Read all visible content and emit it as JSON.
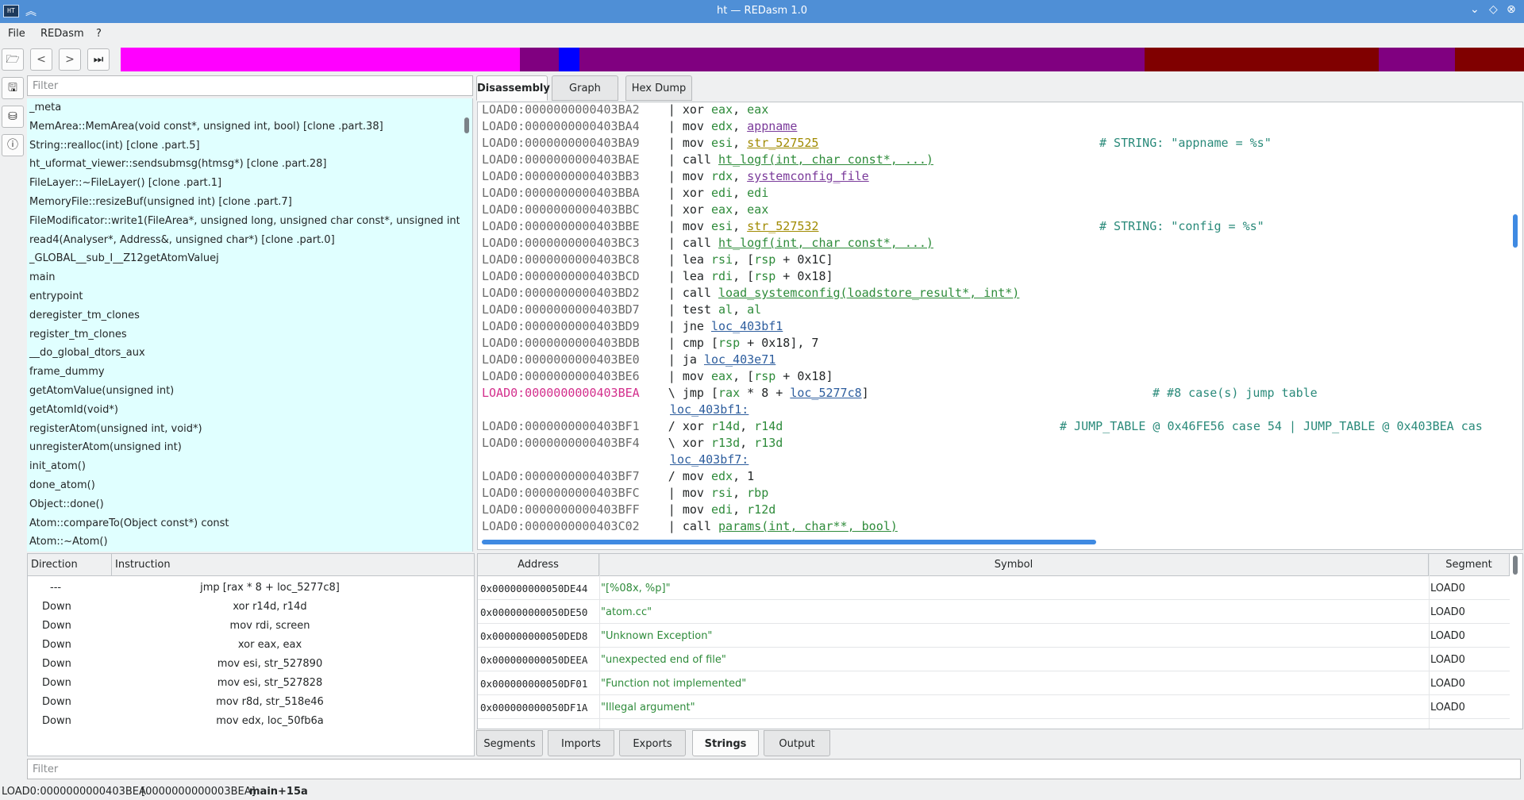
{
  "window": {
    "title": "ht — REDasm 1.0",
    "icon_label": "HT"
  },
  "menu": {
    "items": [
      "File",
      "REDasm",
      "?"
    ]
  },
  "toolbar": {
    "open_icon": "folder-open-icon",
    "back_icon": "arrow-left-icon",
    "forward_icon": "arrow-right-icon",
    "goto_icon": "fast-forward-icon"
  },
  "navbar_colors": [
    {
      "color": "#eff0f1",
      "w": 4
    },
    {
      "color": "#ff00ff",
      "w": 503
    },
    {
      "color": "#800080",
      "w": 49
    },
    {
      "color": "#0000ff",
      "w": 26
    },
    {
      "color": "#800080",
      "w": 712
    },
    {
      "color": "#800000",
      "w": 295
    },
    {
      "color": "#800080",
      "w": 96
    },
    {
      "color": "#800000",
      "w": 87
    }
  ],
  "functions": {
    "filter_placeholder": "Filter",
    "items": [
      "_meta",
      "MemArea::MemArea(void const*, unsigned int, bool) [clone .part.38]",
      "String::realloc(int) [clone .part.5]",
      "ht_uformat_viewer::sendsubmsg(htmsg*) [clone .part.28]",
      "FileLayer::~FileLayer() [clone .part.1]",
      "MemoryFile::resizeBuf(unsigned int) [clone .part.7]",
      "FileModificator::write1(FileArea*, unsigned long, unsigned char const*, unsigned int) [...",
      "read4(Analyser*, Address&, unsigned char*) [clone .part.0]",
      "_GLOBAL__sub_I__Z12getAtomValuej",
      "main",
      "entrypoint",
      "deregister_tm_clones",
      "register_tm_clones",
      "__do_global_dtors_aux",
      "frame_dummy",
      "getAtomValue(unsigned int)",
      "getAtomId(void*)",
      "registerAtom(unsigned int, void*)",
      "unregisterAtom(unsigned int)",
      "init_atom()",
      "done_atom()",
      "Object::done()",
      "Atom::compareTo(Object const*) const",
      "Atom::~Atom()"
    ]
  },
  "view_tabs": [
    "Disassembly",
    "Graph",
    "Hex Dump"
  ],
  "disassembly": [
    {
      "addr": "LOAD0:0000000000403BA2",
      "code": "    | xor eax, eax",
      "cmt": ""
    },
    {
      "addr": "LOAD0:0000000000403BA4",
      "code": "    | mov edx, appname",
      "cmt": ""
    },
    {
      "addr": "LOAD0:0000000000403BA9",
      "code": "    | mov esi, str_527525",
      "cmt": "# STRING: \"appname = %s\""
    },
    {
      "addr": "LOAD0:0000000000403BAE",
      "code": "    | call ht_logf(int, char const*, ...)",
      "cmt": ""
    },
    {
      "addr": "LOAD0:0000000000403BB3",
      "code": "    | mov rdx, systemconfig_file",
      "cmt": ""
    },
    {
      "addr": "LOAD0:0000000000403BBA",
      "code": "    | xor edi, edi",
      "cmt": ""
    },
    {
      "addr": "LOAD0:0000000000403BBC",
      "code": "    | xor eax, eax",
      "cmt": ""
    },
    {
      "addr": "LOAD0:0000000000403BBE",
      "code": "    | mov esi, str_527532",
      "cmt": "# STRING: \"config = %s\""
    },
    {
      "addr": "LOAD0:0000000000403BC3",
      "code": "    | call ht_logf(int, char const*, ...)",
      "cmt": ""
    },
    {
      "addr": "LOAD0:0000000000403BC8",
      "code": "    | lea rsi, [rsp + 0x1C]",
      "cmt": ""
    },
    {
      "addr": "LOAD0:0000000000403BCD",
      "code": "    | lea rdi, [rsp + 0x18]",
      "cmt": ""
    },
    {
      "addr": "LOAD0:0000000000403BD2",
      "code": "    | call load_systemconfig(loadstore_result*, int*)",
      "cmt": ""
    },
    {
      "addr": "LOAD0:0000000000403BD7",
      "code": "    | test al, al",
      "cmt": ""
    },
    {
      "addr": "LOAD0:0000000000403BD9",
      "code": "    | jne loc_403bf1",
      "cmt": ""
    },
    {
      "addr": "LOAD0:0000000000403BDB",
      "code": "    | cmp [rsp + 0x18], 7",
      "cmt": ""
    },
    {
      "addr": "LOAD0:0000000000403BE0",
      "code": "    | ja loc_403e71",
      "cmt": ""
    },
    {
      "addr": "LOAD0:0000000000403BE6",
      "code": "    | mov eax, [rsp + 0x18]",
      "cmt": ""
    },
    {
      "addr": "LOAD0:0000000000403BEA",
      "code": "    \\ jmp [rax * 8 + loc_5277c8]",
      "cmt": "# #8 case(s) jump table",
      "cur": true
    },
    {
      "addr": "",
      "code": "loc_403bf1:",
      "cmt": "",
      "label": true
    },
    {
      "addr": "LOAD0:0000000000403BF1",
      "code": "    / xor r14d, r14d",
      "cmt": "# JUMP_TABLE @ 0x46FE56 case 54 | JUMP_TABLE @ 0x403BEA cas"
    },
    {
      "addr": "LOAD0:0000000000403BF4",
      "code": "    \\ xor r13d, r13d",
      "cmt": ""
    },
    {
      "addr": "",
      "code": "loc_403bf7:",
      "cmt": "",
      "label": true
    },
    {
      "addr": "LOAD0:0000000000403BF7",
      "code": "    / mov edx, 1",
      "cmt": ""
    },
    {
      "addr": "LOAD0:0000000000403BFC",
      "code": "    | mov rsi, rbp",
      "cmt": ""
    },
    {
      "addr": "LOAD0:0000000000403BFF",
      "code": "    | mov edi, r12d",
      "cmt": ""
    },
    {
      "addr": "LOAD0:0000000000403C02",
      "code": "    | call params(int, char**, bool)",
      "cmt": ""
    }
  ],
  "references": {
    "headers": [
      "Direction",
      "Instruction"
    ],
    "rows": [
      {
        "dir": "---",
        "ins": "jmp [rax * 8 + loc_5277c8]"
      },
      {
        "dir": "Down",
        "ins": "xor r14d, r14d"
      },
      {
        "dir": "Down",
        "ins": "mov rdi, screen"
      },
      {
        "dir": "Down",
        "ins": "xor eax, eax"
      },
      {
        "dir": "Down",
        "ins": "mov esi, str_527890"
      },
      {
        "dir": "Down",
        "ins": "mov esi, str_527828"
      },
      {
        "dir": "Down",
        "ins": "mov r8d, str_518e46"
      },
      {
        "dir": "Down",
        "ins": "mov edx, loc_50fb6a"
      }
    ]
  },
  "strings": {
    "headers": [
      "Address",
      "Symbol",
      "Segment"
    ],
    "rows": [
      {
        "addr": "0x000000000050DE44",
        "sym": "\"[%08x, %p]\"",
        "seg": "LOAD0"
      },
      {
        "addr": "0x000000000050DE50",
        "sym": "\"atom.cc\"",
        "seg": "LOAD0"
      },
      {
        "addr": "0x000000000050DED8",
        "sym": "\"Unknown Exception\"",
        "seg": "LOAD0"
      },
      {
        "addr": "0x000000000050DEEA",
        "sym": "\"unexpected end of file\"",
        "seg": "LOAD0"
      },
      {
        "addr": "0x000000000050DF01",
        "sym": "\"Function not implemented\"",
        "seg": "LOAD0"
      },
      {
        "addr": "0x000000000050DF1A",
        "sym": "\"Illegal argument\"",
        "seg": "LOAD0"
      }
    ]
  },
  "bottom_tabs": [
    "Segments",
    "Imports",
    "Exports",
    "Strings",
    "Output"
  ],
  "bottom_filter_placeholder": "Filter",
  "status": {
    "address": "LOAD0:0000000000403BEA",
    "offset": "[0000000000003BEA]",
    "location": "main+15a"
  }
}
